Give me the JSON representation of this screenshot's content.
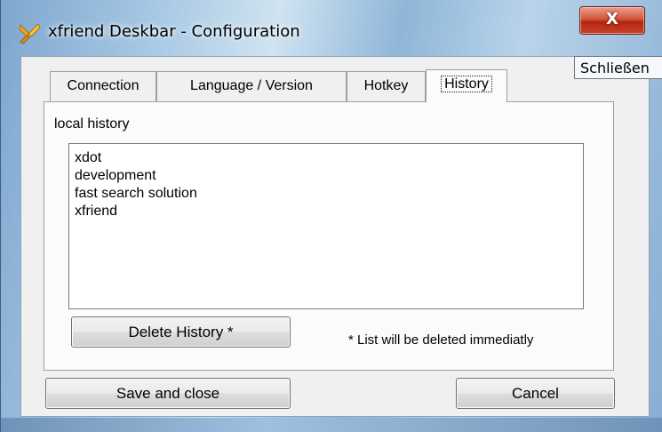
{
  "window": {
    "title": "xfriend Deskbar - Configuration",
    "close_glyph": "X",
    "tooltip": "Schließen"
  },
  "tabs": [
    {
      "label": "Connection",
      "active": false
    },
    {
      "label": "Language / Version",
      "active": false
    },
    {
      "label": "Hotkey",
      "active": false
    },
    {
      "label": "History",
      "active": true
    }
  ],
  "history": {
    "group_label": "local history",
    "items": [
      "xdot",
      "development",
      "fast search solution",
      "xfriend"
    ],
    "delete_button": "Delete History *",
    "note": "* List will be deleted immediatly"
  },
  "footer": {
    "save_button": "Save and close",
    "cancel_button": "Cancel"
  },
  "colors": {
    "close_button": "#c7432a",
    "window_background": "#f0f0f0",
    "frame_glass": "#a9c9e4"
  },
  "icons": {
    "app": "xfriend-logo-icon",
    "close": "close-icon"
  }
}
